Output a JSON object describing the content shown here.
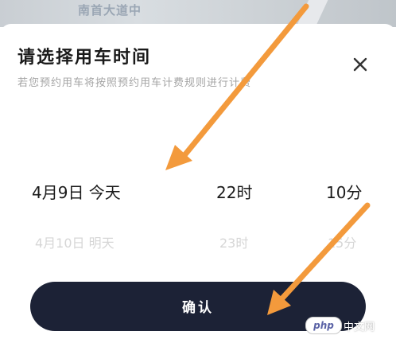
{
  "background_map": {
    "road_label": "南首大道中"
  },
  "sheet": {
    "title": "请选择用车时间",
    "subtitle": "若您预约用车将按照预约用车计费规则进行计费",
    "close_icon": "close-icon"
  },
  "picker": {
    "selected": {
      "date": "4月9日  今天",
      "hour": "22时",
      "minute": "10分"
    },
    "next": {
      "date": "4月10日  明天",
      "hour": "23时",
      "minute": "15分"
    }
  },
  "confirm": {
    "label": "确认"
  },
  "watermark": {
    "badge": "php",
    "text": "中文网"
  },
  "colors": {
    "button_bg": "#1c2236",
    "arrow": "#f39a3c",
    "title_text": "#1a1a1a",
    "subtitle_text": "#a4a4a4",
    "dim_text": "#d6d6d6"
  }
}
